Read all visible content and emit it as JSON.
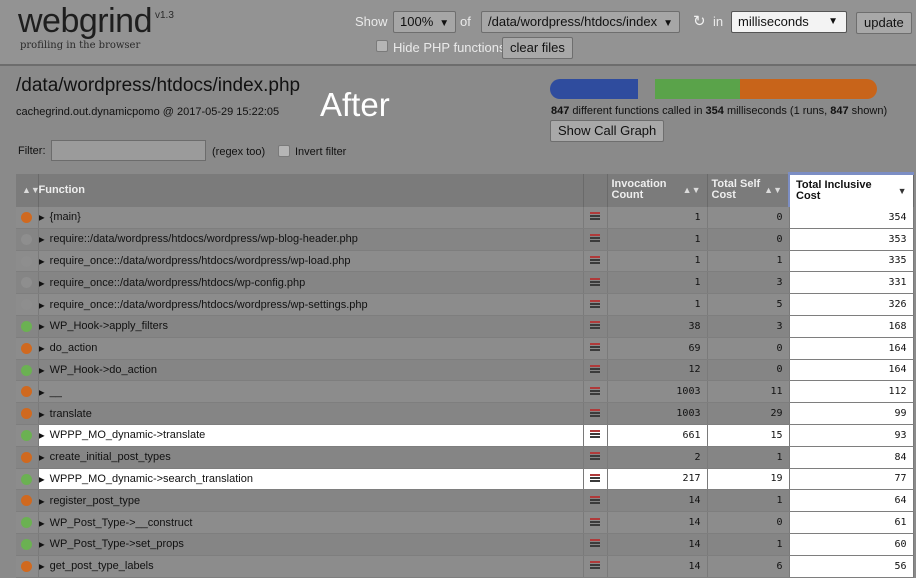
{
  "logo": {
    "title": "webgrind",
    "version": "v1.3",
    "tagline": "profiling in the browser"
  },
  "controls": {
    "show_label": "Show",
    "percent_value": "100%",
    "of_label": "of",
    "file_value": "/data/wordpress/htdocs/index",
    "reload_icon": "reload-icon",
    "in_label": "in",
    "unit_value": "milliseconds",
    "update_label": "update",
    "hide_php_label": "Hide PHP functions",
    "clear_files_label": "clear files"
  },
  "info": {
    "file_title": "/data/wordpress/htdocs/index.php",
    "subtitle": "cachegrind.out.dynamicpomo @ 2017-05-29 15:22:05",
    "overlay_label": "After",
    "filter_label": "Filter:",
    "filter_value": "",
    "regex_label": "(regex too)",
    "invert_label": "Invert filter",
    "stats": {
      "functions": "847",
      "t1": " different functions called in ",
      "ms": "354",
      "t2": " milliseconds (1 runs, ",
      "shown": "847",
      "t3": " shown)"
    },
    "call_graph_label": "Show Call Graph",
    "breakdown_bar": [
      {
        "color": "#2f4c9e",
        "share": 0.27
      },
      {
        "color": "#8a8a8a",
        "share": 0.05
      },
      {
        "color": "#5aa34a",
        "share": 0.26
      },
      {
        "color": "#c8641a",
        "share": 0.42
      }
    ]
  },
  "colors": {
    "internal": "#d0691f",
    "include": "#8e8e8e",
    "user": "#6bb152",
    "highlight": "#ffffff",
    "highlight_border": "#7c8ec4"
  },
  "table": {
    "headers": {
      "function": "Function",
      "invocation": "Invocation Count",
      "self": "Total Self Cost",
      "inclusive": "Total Inclusive Cost"
    },
    "rows": [
      {
        "dot": "internal",
        "fn": "{main}",
        "inv": "1",
        "self": "0",
        "incl": "354",
        "wh": false
      },
      {
        "dot": "include",
        "fn": "require::/data/wordpress/htdocs/wordpress/wp-blog-header.php",
        "inv": "1",
        "self": "0",
        "incl": "353",
        "wh": false
      },
      {
        "dot": "include",
        "fn": "require_once::/data/wordpress/htdocs/wordpress/wp-load.php",
        "inv": "1",
        "self": "1",
        "incl": "335",
        "wh": false
      },
      {
        "dot": "include",
        "fn": "require_once::/data/wordpress/htdocs/wp-config.php",
        "inv": "1",
        "self": "3",
        "incl": "331",
        "wh": false
      },
      {
        "dot": "include",
        "fn": "require_once::/data/wordpress/htdocs/wordpress/wp-settings.php",
        "inv": "1",
        "self": "5",
        "incl": "326",
        "wh": false
      },
      {
        "dot": "user",
        "fn": "WP_Hook->apply_filters",
        "inv": "38",
        "self": "3",
        "incl": "168",
        "wh": false
      },
      {
        "dot": "internal",
        "fn": "do_action",
        "inv": "69",
        "self": "0",
        "incl": "164",
        "wh": false
      },
      {
        "dot": "user",
        "fn": "WP_Hook->do_action",
        "inv": "12",
        "self": "0",
        "incl": "164",
        "wh": false
      },
      {
        "dot": "internal",
        "fn": "__",
        "inv": "1003",
        "self": "11",
        "incl": "112",
        "wh": false
      },
      {
        "dot": "internal",
        "fn": "translate",
        "inv": "1003",
        "self": "29",
        "incl": "99",
        "wh": false
      },
      {
        "dot": "user",
        "fn": "WPPP_MO_dynamic->translate",
        "inv": "661",
        "self": "15",
        "incl": "93",
        "wh": true
      },
      {
        "dot": "internal",
        "fn": "create_initial_post_types",
        "inv": "2",
        "self": "1",
        "incl": "84",
        "wh": false
      },
      {
        "dot": "user",
        "fn": "WPPP_MO_dynamic->search_translation",
        "inv": "217",
        "self": "19",
        "incl": "77",
        "wh": true
      },
      {
        "dot": "internal",
        "fn": "register_post_type",
        "inv": "14",
        "self": "1",
        "incl": "64",
        "wh": false
      },
      {
        "dot": "user",
        "fn": "WP_Post_Type->__construct",
        "inv": "14",
        "self": "0",
        "incl": "61",
        "wh": false
      },
      {
        "dot": "user",
        "fn": "WP_Post_Type->set_props",
        "inv": "14",
        "self": "1",
        "incl": "60",
        "wh": false
      },
      {
        "dot": "internal",
        "fn": "get_post_type_labels",
        "inv": "14",
        "self": "6",
        "incl": "56",
        "wh": false
      }
    ]
  }
}
